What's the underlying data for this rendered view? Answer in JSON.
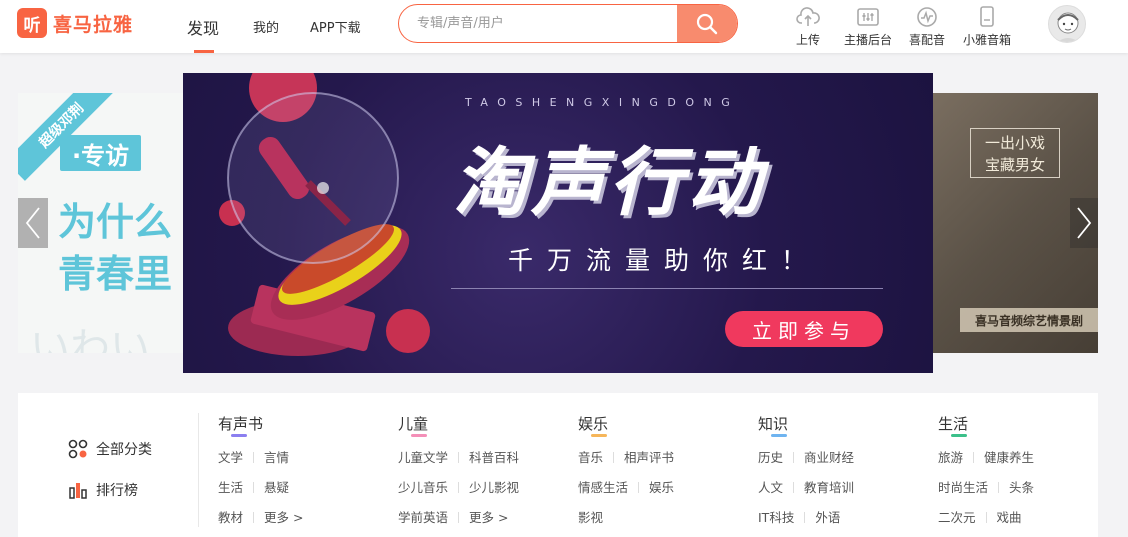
{
  "header": {
    "logo_badge": "听",
    "logo_text": "喜马拉雅",
    "nav": {
      "discover": "发现",
      "mine": "我的",
      "app": "APP下载"
    },
    "search_placeholder": "专辑/声音/用户",
    "tools": [
      {
        "label": "上传",
        "icon": "upload-cloud-icon"
      },
      {
        "label": "主播后台",
        "icon": "mixer-icon"
      },
      {
        "label": "喜配音",
        "icon": "waveform-icon"
      },
      {
        "label": "小雅音箱",
        "icon": "speaker-icon"
      }
    ],
    "accent": "#f86442"
  },
  "banner": {
    "left": {
      "ribbon": "超级邓荆",
      "tag": "·专访",
      "line1": "为什么",
      "line2": "青春里",
      "faded": "いわい"
    },
    "main": {
      "letters": "TAOSHENGXINGDONG",
      "title": "淘声行动",
      "subtitle": "千万流量助你红！",
      "cta": "立即参与"
    },
    "right": {
      "frame_line1": "一出小戏",
      "frame_line2": "宝藏男女",
      "caption": "喜马音频综艺情景剧"
    }
  },
  "categories": {
    "quick": [
      {
        "label": "全部分类",
        "icon": "grid-category-icon"
      },
      {
        "label": "排行榜",
        "icon": "bar-chart-icon"
      }
    ],
    "columns": [
      {
        "title": "有声书",
        "color": "#8b7ff0",
        "rows": [
          [
            "文学",
            "言情"
          ],
          [
            "生活",
            "悬疑"
          ],
          [
            "教材",
            "更多 >"
          ]
        ]
      },
      {
        "title": "儿童",
        "color": "#f48fb8",
        "rows": [
          [
            "儿童文学",
            "科普百科"
          ],
          [
            "少儿音乐",
            "少儿影视"
          ],
          [
            "学前英语",
            "更多 >"
          ]
        ]
      },
      {
        "title": "娱乐",
        "color": "#f6b65a",
        "rows": [
          [
            "音乐",
            "相声评书"
          ],
          [
            "情感生活",
            "娱乐"
          ],
          [
            "影视"
          ]
        ]
      },
      {
        "title": "知识",
        "color": "#6fb4f0",
        "rows": [
          [
            "历史",
            "商业财经"
          ],
          [
            "人文",
            "教育培训"
          ],
          [
            "IT科技",
            "外语"
          ]
        ]
      },
      {
        "title": "生活",
        "color": "#3cc08a",
        "rows": [
          [
            "旅游",
            "健康养生"
          ],
          [
            "时尚生活",
            "头条"
          ],
          [
            "二次元",
            "戏曲"
          ]
        ]
      }
    ]
  }
}
